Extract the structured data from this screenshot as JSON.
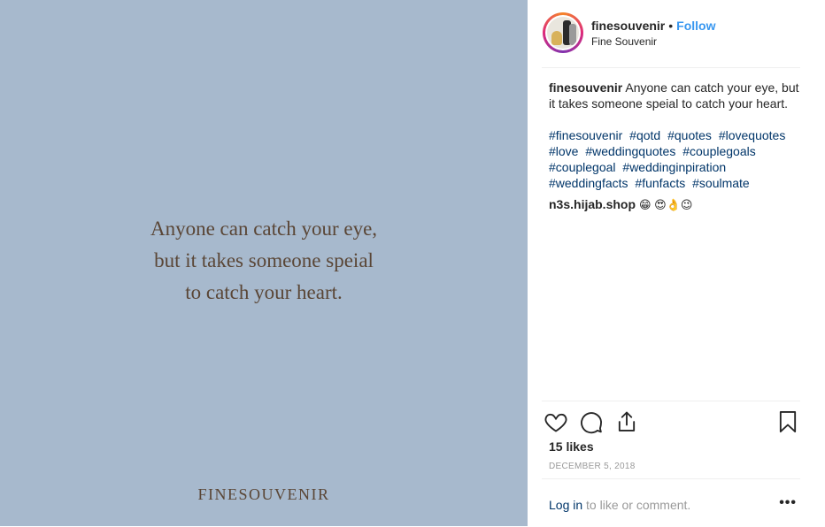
{
  "media": {
    "quote_lines": [
      "Anyone can catch your eye,",
      "but it takes someone speial",
      "to catch your heart."
    ],
    "brand": "FINESOUVENIR",
    "background": "#a7b9cd",
    "text_color": "#5a4636"
  },
  "header": {
    "username": "finesouvenir",
    "separator": "•",
    "follow_label": "Follow",
    "full_name": "Fine Souvenir"
  },
  "caption": {
    "username": "finesouvenir",
    "text": "Anyone can catch your eye, but it takes someone speial to catch your heart.",
    "hashtags": [
      "#finesouvenir",
      "#qotd",
      "#quotes",
      "#lovequotes",
      "#love",
      "#weddingquotes",
      "#couplegoals",
      "#couplegoal",
      "#weddinginpiration",
      "#weddingfacts",
      "#funfacts",
      "#soulmate"
    ]
  },
  "comment": {
    "username": "n3s.hijab.shop",
    "emojis": "😁 😍👌😉"
  },
  "actions": {
    "like_icon": "heart-icon",
    "comment_icon": "comment-icon",
    "share_icon": "share-icon",
    "save_icon": "bookmark-icon"
  },
  "likes": "15 likes",
  "date": "DECEMBER 5, 2018",
  "login": {
    "link_text": "Log in",
    "rest_text": " to like or comment.",
    "more_label": "•••"
  },
  "colors": {
    "link": "#003569",
    "follow": "#3897f0",
    "muted": "#999999"
  }
}
